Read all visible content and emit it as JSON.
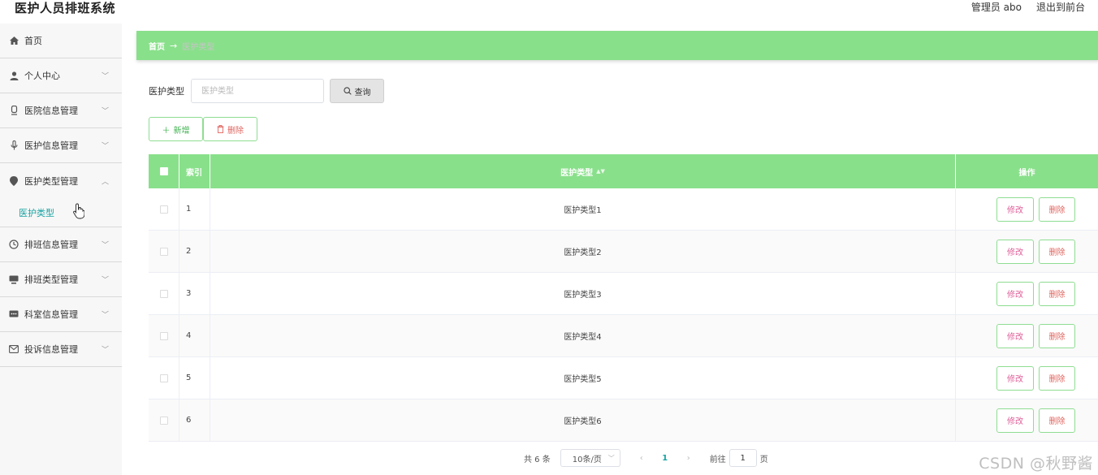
{
  "header": {
    "app_title": "医护人员排班系统",
    "user": "管理员 abo",
    "exit": "退出到前台"
  },
  "sidebar": {
    "items": [
      {
        "label": "首页",
        "icon": "home-icon"
      },
      {
        "label": "个人中心",
        "icon": "user-icon"
      },
      {
        "label": "医院信息管理",
        "icon": "hospital-icon"
      },
      {
        "label": "医护信息管理",
        "icon": "microphone-icon"
      },
      {
        "label": "医护类型管理",
        "icon": "location-icon",
        "expanded": true
      },
      {
        "label": "排班信息管理",
        "icon": "clock-icon"
      },
      {
        "label": "排班类型管理",
        "icon": "monitor-icon"
      },
      {
        "label": "科室信息管理",
        "icon": "chat-icon"
      },
      {
        "label": "投诉信息管理",
        "icon": "mail-icon"
      }
    ],
    "sub_item": "医护类型"
  },
  "breadcrumb": {
    "home": "首页",
    "arrow": "→",
    "current": "医护类型"
  },
  "search": {
    "label": "医护类型",
    "placeholder": "医护类型",
    "query_label": "查询"
  },
  "actions": {
    "add_label": "新增",
    "delete_label": "删除"
  },
  "table": {
    "headers": {
      "index": "索引",
      "type": "医护类型",
      "operation": "操作"
    },
    "edit_label": "修改",
    "delete_label": "删除",
    "rows": [
      {
        "index": "1",
        "type": "医护类型1"
      },
      {
        "index": "2",
        "type": "医护类型2"
      },
      {
        "index": "3",
        "type": "医护类型3"
      },
      {
        "index": "4",
        "type": "医护类型4"
      },
      {
        "index": "5",
        "type": "医护类型5"
      },
      {
        "index": "6",
        "type": "医护类型6"
      }
    ]
  },
  "pagination": {
    "total": "共 6 条",
    "page_size": "10条/页",
    "current_page": "1",
    "goto_label": "前往",
    "goto_value": "1",
    "page_suffix": "页"
  },
  "watermark": "CSDN @秋野酱",
  "colors": {
    "accent_green": "#89e08b",
    "teal": "#1aa2a2",
    "danger": "#e0655f",
    "edit_pink": "#e0609a"
  }
}
